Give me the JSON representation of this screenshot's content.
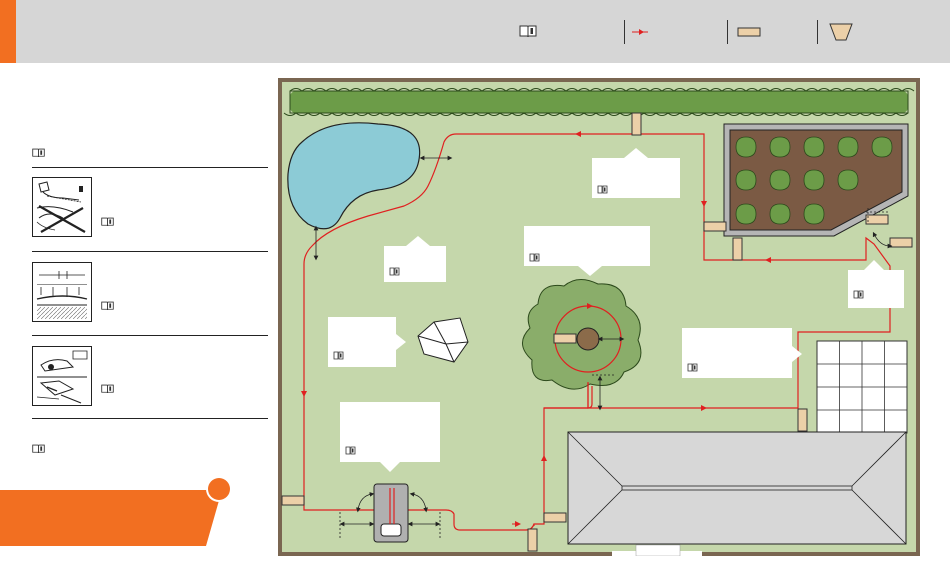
{
  "colors": {
    "accent": "#f26f21",
    "header_bg": "#d6d6d6",
    "lawn": "#c5d7ab",
    "hedge": "#6c9c48",
    "pond": "#8ccbd6",
    "boundary_wire": "#e02020",
    "guide_marker": "#ecd0a8",
    "wall": "#7a6651",
    "garden_bed": "#7b5a44",
    "house_roof": "#d7d7d7"
  },
  "legend": {
    "items": [
      {
        "icon": "book-icon"
      },
      {
        "icon": "wire-symbol-icon"
      },
      {
        "icon": "peg-symbol-icon"
      },
      {
        "icon": "funnel-symbol-icon"
      }
    ]
  },
  "sidebar": {
    "rows": [
      {
        "icon": "cable-laying-illustration-icon"
      },
      {
        "icon": "cable-depth-illustration-icon"
      },
      {
        "icon": "mower-cutting-illustration-icon"
      }
    ]
  }
}
